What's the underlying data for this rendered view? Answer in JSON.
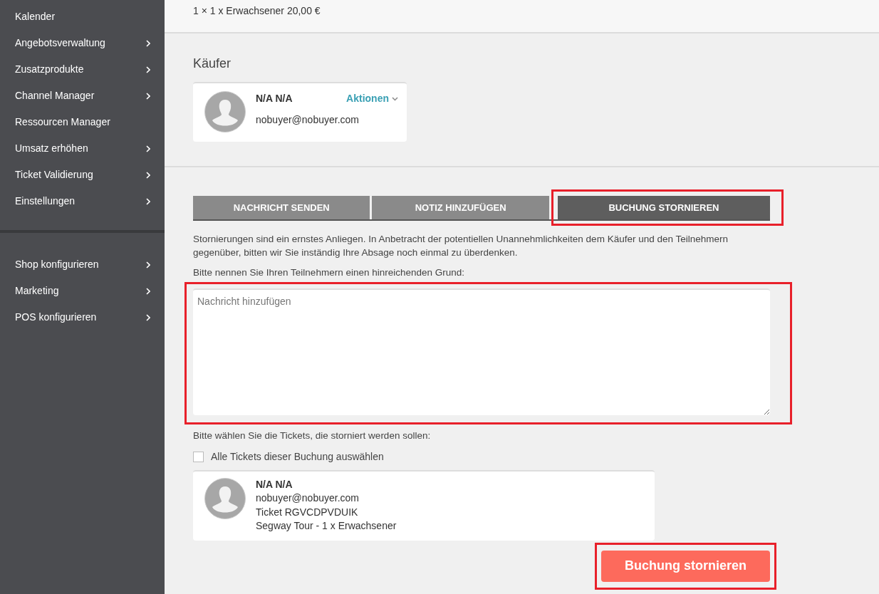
{
  "sidebar": {
    "groups": [
      [
        {
          "label": "Kalender",
          "has_submenu": false
        },
        {
          "label": "Angebotsverwaltung",
          "has_submenu": true
        },
        {
          "label": "Zusatzprodukte",
          "has_submenu": true
        },
        {
          "label": "Channel Manager",
          "has_submenu": true
        },
        {
          "label": "Ressourcen Manager",
          "has_submenu": false
        },
        {
          "label": "Umsatz erhöhen",
          "has_submenu": true
        },
        {
          "label": "Ticket Validierung",
          "has_submenu": true
        },
        {
          "label": "Einstellungen",
          "has_submenu": true
        }
      ],
      [
        {
          "label": "Shop konfigurieren",
          "has_submenu": true
        },
        {
          "label": "Marketing",
          "has_submenu": true
        },
        {
          "label": "POS konfigurieren",
          "has_submenu": true
        }
      ]
    ]
  },
  "order_line": "1 × 1 x Erwachsener 20,00 €",
  "buyer": {
    "heading": "Käufer",
    "name": "N/A N/A",
    "email": "nobuyer@nobuyer.com",
    "actions": "Aktionen"
  },
  "tabs": [
    {
      "label": "NACHRICHT SENDEN",
      "selected": false,
      "highlighted": false
    },
    {
      "label": "NOTIZ HINZUFÜGEN",
      "selected": false,
      "highlighted": false
    },
    {
      "label": "BUCHUNG STORNIEREN",
      "selected": true,
      "highlighted": true
    }
  ],
  "warning": "Stornierungen sind ein ernstes Anliegen. In Anbetracht der potentiellen Unannehmlichkeiten dem Käufer und den Teilnehmern gegenüber, bitten wir Sie inständig Ihre Absage noch einmal zu überdenken.",
  "reason_prompt": "Bitte nennen Sie Ihren Teilnehmern einen hinreichenden Grund:",
  "message": {
    "placeholder": "Nachricht hinzufügen",
    "highlighted": true
  },
  "tickets_prompt": "Bitte wählen Sie die Tickets, die storniert werden sollen:",
  "select_all": {
    "label": "Alle Tickets dieser Buchung auswählen",
    "checked": false
  },
  "tickets": [
    {
      "name": "N/A N/A",
      "email": "nobuyer@nobuyer.com",
      "ticket": "Ticket RGVCDPVDUIK",
      "product": "Segway Tour - 1 x Erwachsener"
    }
  ],
  "submit": {
    "label": "Buchung stornieren",
    "highlighted": true
  }
}
